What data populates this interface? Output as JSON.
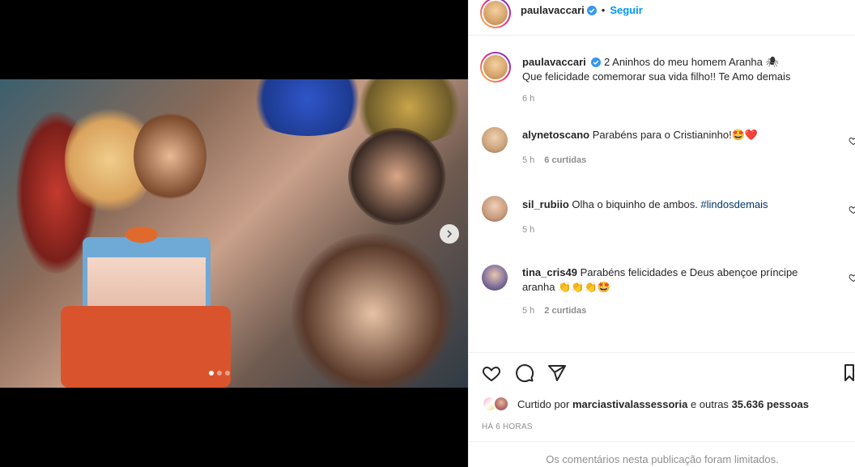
{
  "post": {
    "author": "paulavaccari",
    "follow_label": "Seguir",
    "bullet": "•",
    "caption": "2 Aninhos do meu homem Aranha 🕷",
    "caption_line2": "Que felicidade comemorar sua vida filho!! Te Amo demais",
    "caption_time": "6 h"
  },
  "comments": [
    {
      "user": "alynetoscano",
      "text": "Parabéns para o Cristianinho!🤩❤️",
      "time": "5 h",
      "likes": "6 curtidas"
    },
    {
      "user": "sil_rubiio",
      "text": "Olha o biquinho de ambos. ",
      "hashtag": "#lindosdemais",
      "time": "5 h"
    },
    {
      "user": "tina_cris49",
      "text": "Parabéns felicidades e Deus abençoe príncipe",
      "text_line2": "aranha 👏👏👏🤩",
      "time": "5 h",
      "likes": "2 curtidas"
    }
  ],
  "likes": {
    "prefix": "Curtido por",
    "user": "marciastivalassessoria",
    "conj": "e outras",
    "count": "35.636 pessoas"
  },
  "time_ago": "HÁ 6 HORAS",
  "limited_comments": "Os comentários nesta publicação foram limitados.",
  "carousel": {
    "slide": 1,
    "total": 3
  },
  "colors": {
    "accent": "#0095f6",
    "text": "#262626",
    "muted": "#8e8e8e",
    "verified": "#3897f0"
  }
}
